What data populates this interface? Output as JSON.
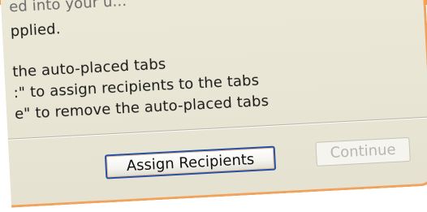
{
  "dialog": {
    "lines": [
      "ed into your u...",
      "pplied.",
      "the auto-placed tabs",
      ":\" to assign recipients to the tabs",
      "e\" to remove the auto-placed tabs"
    ],
    "buttons": {
      "assign": "Assign Recipients",
      "continue": "Continue"
    }
  },
  "colors": {
    "accent_border": "#f0a35c",
    "dialog_bg": "#ece9d8",
    "default_button_border": "#2a4ea6",
    "disabled_text": "#b9b7ad"
  }
}
